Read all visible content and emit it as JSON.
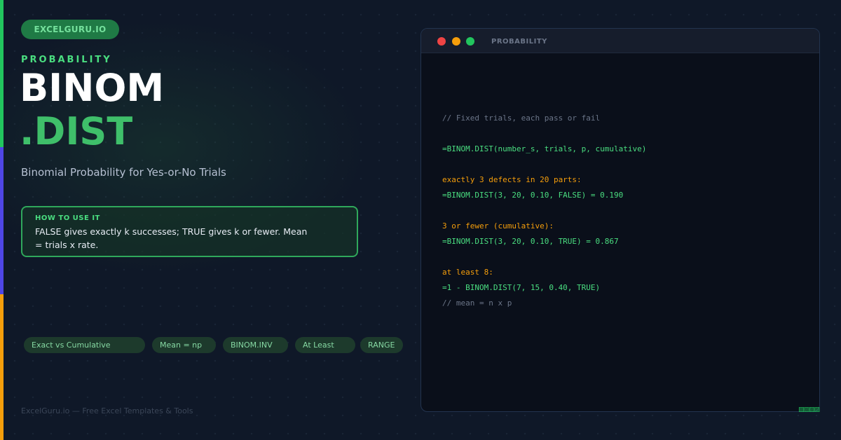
{
  "brand": {
    "badge": "EXCELGURU.IO"
  },
  "header": {
    "category": "PROBABILITY",
    "title_line1": "BINOM",
    "title_line2": ".DIST",
    "subtitle": "Binomial Probability for Yes-or-No Trials"
  },
  "howto": {
    "label": "HOW TO USE IT",
    "text": "FALSE gives exactly k successes; TRUE gives k or fewer. Mean = trials x rate."
  },
  "tags": [
    "Exact vs Cumulative",
    "Mean = np",
    "BINOM.INV",
    "At Least",
    "RANGE"
  ],
  "footer": {
    "text": "ExcelGuru.io — Free Excel Templates & Tools"
  },
  "window": {
    "title": "PROBABILITY",
    "code": [
      "// Fixed trials, each pass or fail",
      "=BINOM.DIST(number_s, trials, p, cumulative)",
      "exactly 3 defects in 20 parts:",
      "=BINOM.DIST(3, 20, 0.10, FALSE) = 0.190",
      "3 or fewer (cumulative):",
      "=BINOM.DIST(3, 20, 0.10, TRUE) = 0.867",
      "at least 8:",
      "=1 - BINOM.DIST(7, 15, 0.40, TRUE)",
      "// mean = n x p"
    ]
  },
  "colors": {
    "accent_green": "#22c55e",
    "accent_indigo": "#4f46e5",
    "accent_amber": "#f59e0b",
    "background": "#0f1828",
    "window_background": "#0a0f1a"
  },
  "icons": {
    "window_controls": [
      "close-dot",
      "minimize-dot",
      "maximize-dot"
    ],
    "corner_mark": "pattern-icon"
  }
}
